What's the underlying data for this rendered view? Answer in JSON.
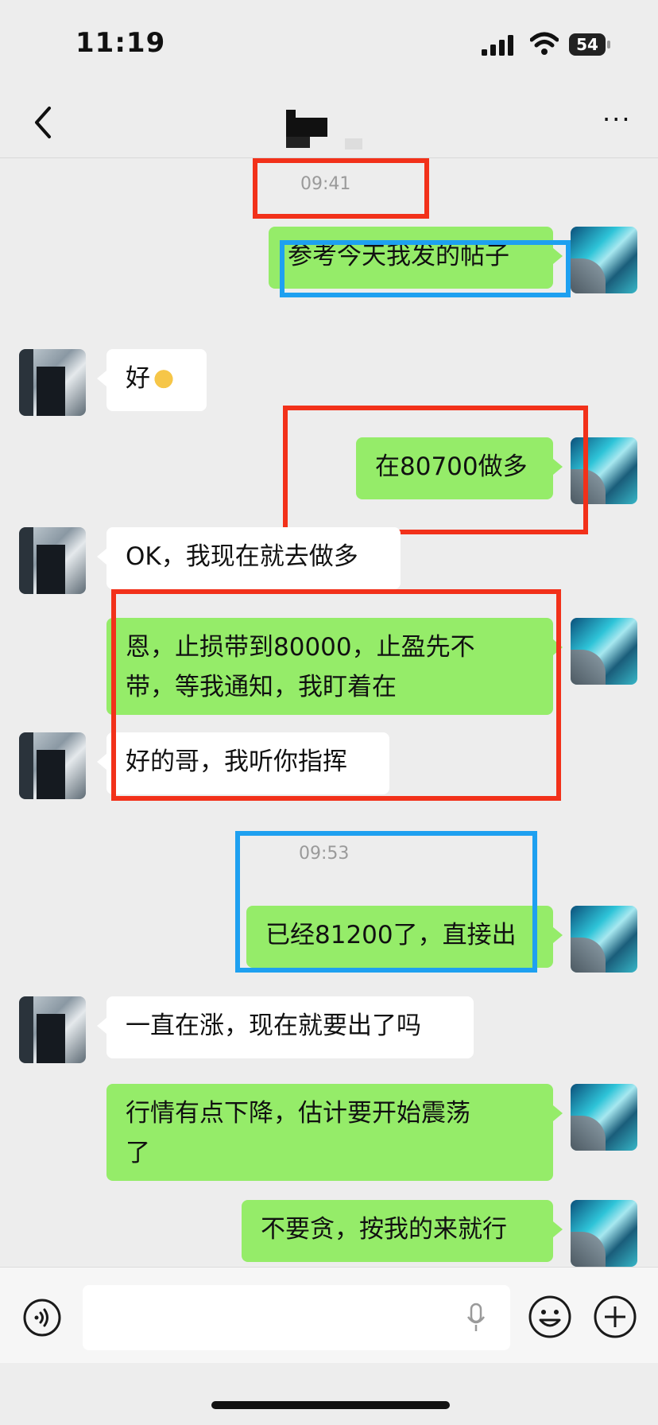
{
  "status_bar": {
    "time": "11:19",
    "battery": "54"
  },
  "nav": {
    "back_icon": "chevron-left-icon",
    "more_icon": "more-icon",
    "more_label": "···"
  },
  "messages": [
    {
      "kind": "timestamp",
      "text": "09:41"
    },
    {
      "kind": "me",
      "text": "参考今天我发的帖子"
    },
    {
      "kind": "other",
      "text": "好"
    },
    {
      "kind": "me",
      "text": "在80700做多"
    },
    {
      "kind": "other",
      "text": "OK，我现在就去做多"
    },
    {
      "kind": "me",
      "line1": "恩，止损带到80000，止盈先不",
      "line2": "带，等我通知，我盯着在"
    },
    {
      "kind": "other",
      "text": "好的哥，我听你指挥"
    },
    {
      "kind": "timestamp",
      "text": "09:53"
    },
    {
      "kind": "me",
      "text": "已经81200了，直接出"
    },
    {
      "kind": "other",
      "text": "一直在涨，现在就要出了吗"
    },
    {
      "kind": "me",
      "line1": "行情有点下降，估计要开始震荡",
      "line2": "了"
    },
    {
      "kind": "me",
      "text": "不要贪，按我的来就行"
    }
  ],
  "colors": {
    "me_bubble": "#95ec69",
    "other_bubble": "#ffffff",
    "highlight_red": "#f2311a",
    "highlight_blue": "#1ea0f0"
  },
  "input_bar": {
    "voice_icon": "voice-icon",
    "mic_icon": "microphone-icon",
    "emoji_icon": "emoji-icon",
    "plus_icon": "plus-icon"
  }
}
